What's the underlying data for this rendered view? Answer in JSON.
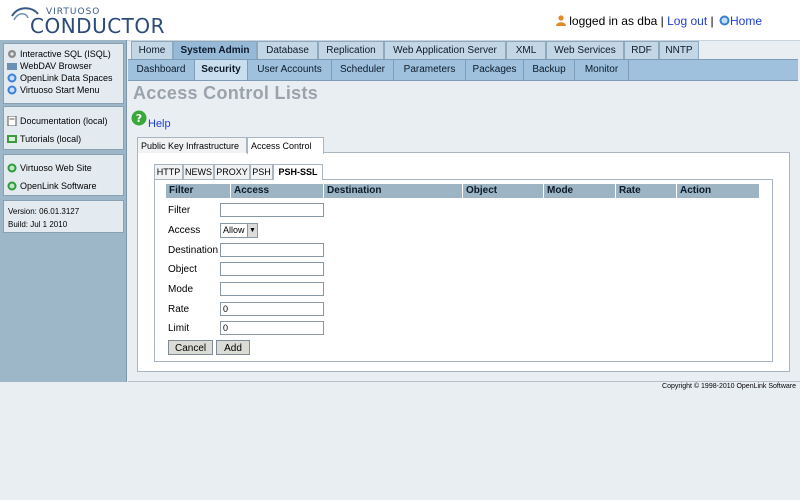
{
  "header": {
    "logo_small": "VIRTUOSO",
    "logo_big": "CONDUCTOR",
    "logged_in_text": "logged in as dba",
    "separator": "|",
    "logout_label": "Log out",
    "separator2": "|",
    "home_label": "Home"
  },
  "sidebar": {
    "group1": [
      "Interactive SQL (ISQL)",
      "WebDAV Browser",
      "OpenLink Data Spaces",
      "Virtuoso Start Menu"
    ],
    "group2": [
      "Documentation (local)",
      "Tutorials (local)"
    ],
    "group3": [
      "Virtuoso Web Site",
      "OpenLink Software"
    ],
    "version": "Version: 06.01.3127",
    "build": "Build: Jul 1 2010"
  },
  "main_tabs": [
    "Home",
    "System Admin",
    "Database",
    "Replication",
    "Web Application Server",
    "XML",
    "Web Services",
    "RDF",
    "NNTP"
  ],
  "sub_tabs": [
    "Dashboard",
    "Security",
    "User Accounts",
    "Scheduler",
    "Parameters",
    "Packages",
    "Backup",
    "Monitor"
  ],
  "page_title": "Access Control Lists",
  "help_label": "Help",
  "section_tabs": [
    "Public Key Infrastructure",
    "Access Control"
  ],
  "protocol_tabs": [
    "HTTP",
    "NEWS",
    "PROXY",
    "PSH",
    "PSH-SSL"
  ],
  "table_headers": [
    "Filter",
    "Access",
    "Destination",
    "Object",
    "Mode",
    "Rate",
    "Action"
  ],
  "form": {
    "filter_label": "Filter",
    "access_label": "Access",
    "access_value": "Allow",
    "destination_label": "Destination",
    "object_label": "Object",
    "mode_label": "Mode",
    "rate_label": "Rate",
    "rate_value": "0",
    "limit_label": "Limit",
    "limit_value": "0",
    "cancel_label": "Cancel",
    "add_label": "Add"
  },
  "footer": "Copyright © 1998-2010 OpenLink Software",
  "colors": {
    "sidebar_bg": "#9db6c8",
    "tab_active": "#95b9d7",
    "link": "#1f3fd3",
    "title_gray": "#9aa3ab"
  }
}
